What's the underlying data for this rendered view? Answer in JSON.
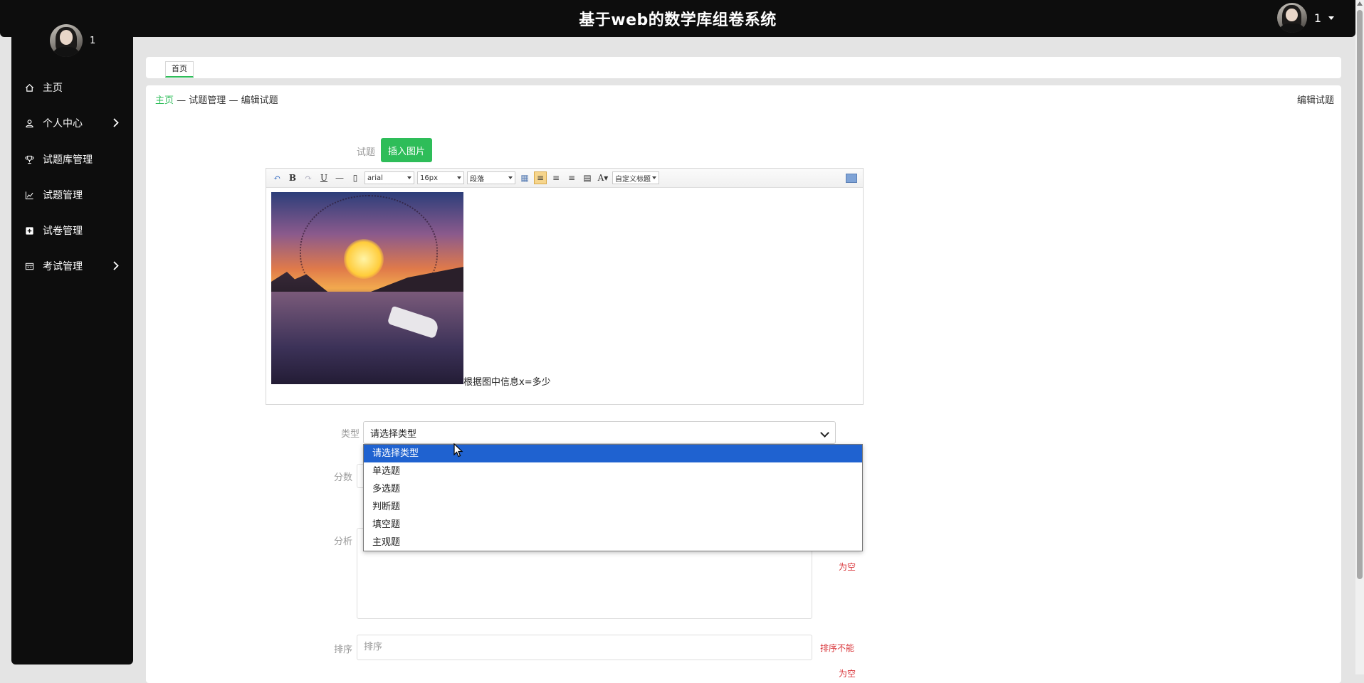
{
  "header": {
    "title": "基于web的数学库组卷系统",
    "user_name": "1"
  },
  "sidebar": {
    "user_name": "1",
    "items": [
      {
        "label": "主页",
        "icon": "home-icon",
        "has_arrow": false
      },
      {
        "label": "个人中心",
        "icon": "user-icon",
        "has_arrow": true
      },
      {
        "label": "试题库管理",
        "icon": "trophy-icon",
        "has_arrow": false
      },
      {
        "label": "试题管理",
        "icon": "chart-icon",
        "has_arrow": false
      },
      {
        "label": "试卷管理",
        "icon": "plus-square-icon",
        "has_arrow": false
      },
      {
        "label": "考试管理",
        "icon": "calendar-icon",
        "has_arrow": true
      }
    ]
  },
  "tabs": [
    {
      "label": "首页",
      "active": true
    }
  ],
  "breadcrumb": {
    "home": "主页",
    "separator": "—",
    "level2": "试题管理",
    "level3": "编辑试题"
  },
  "page_heading": "编辑试题",
  "form": {
    "question_label": "试题",
    "insert_image_button": "插入图片",
    "editor": {
      "font_family": "arial",
      "font_size": "16px",
      "paragraph": "段落",
      "custom_title": "自定义标题",
      "content_text": "根据图中信息x=多少"
    },
    "type_label": "类型",
    "type_value": "请选择类型",
    "type_options": [
      "请选择类型",
      "单选题",
      "多选题",
      "判断题",
      "填空题",
      "主观题"
    ],
    "score_label": "分数",
    "analysis_label": "分析",
    "analysis_error": "为空",
    "sort_label": "排序",
    "sort_placeholder": "排序",
    "sort_error": "排序不能",
    "sort_error_2": "为空"
  },
  "colors": {
    "accent": "#2ebd59",
    "sidebar_bg": "#0d0d0d",
    "error": "#d9353a",
    "selected_option": "#1f62d0"
  }
}
